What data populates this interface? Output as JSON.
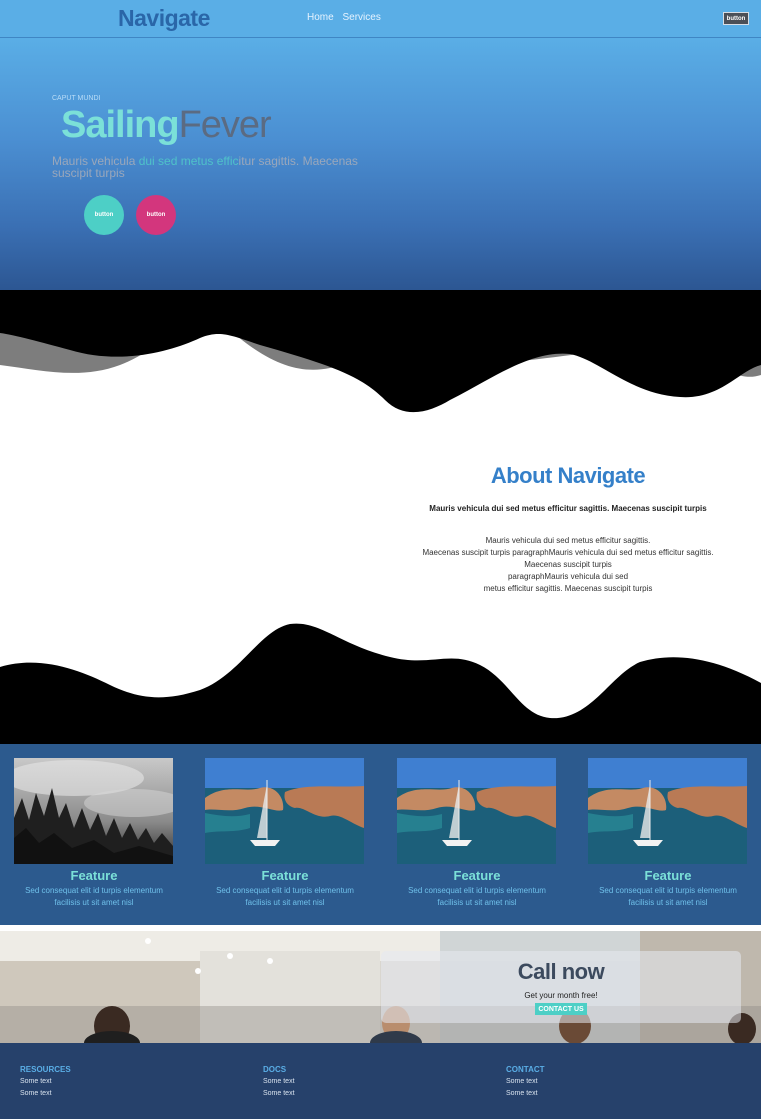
{
  "nav": {
    "brand": "Navigate",
    "links": [
      "Home",
      "Services"
    ],
    "button_label": "button"
  },
  "hero": {
    "kicker": "CAPUT MUNDI",
    "title_part1": "Sailing",
    "title_part2": "Fever",
    "subtitle_part1": "Mauris vehicula ",
    "subtitle_highlight": "dui sed metus effic",
    "subtitle_part2": "itur sagittis. Maecenas suscipit turpis",
    "button1_label": "button",
    "button2_label": "button"
  },
  "about": {
    "title": "About Navigate",
    "lead": "Mauris vehicula dui sed metus efficitur sagittis. Maecenas suscipit turpis",
    "body_lines": [
      "Mauris vehicula dui sed metus efficitur sagittis.",
      "Maecenas suscipit turpis paragraphMauris vehicula dui sed metus efficitur sagittis.",
      "Maecenas suscipit turpis",
      "paragraphMauris vehicula dui sed",
      "metus efficitur sagittis. Maecenas suscipit turpis"
    ]
  },
  "features": [
    {
      "title": "Feature",
      "desc": "Sed consequat elit id turpis elementum facilisis ut sit amet nisl",
      "image": "misty-forest"
    },
    {
      "title": "Feature",
      "desc": "Sed consequat elit id turpis elementum facilisis ut sit amet nisl",
      "image": "sailboat-cove"
    },
    {
      "title": "Feature",
      "desc": "Sed consequat elit id turpis elementum facilisis ut sit amet nisl",
      "image": "sailboat-cove"
    },
    {
      "title": "Feature",
      "desc": "Sed consequat elit id turpis elementum facilisis ut sit amet nisl",
      "image": "sailboat-cove"
    }
  ],
  "call": {
    "title": "Call now",
    "subtitle": "Get your month free!",
    "button_label": "CONTACT US"
  },
  "footer": {
    "columns": [
      {
        "heading": "RESOURCES",
        "links": [
          "Some text",
          "Some text"
        ]
      },
      {
        "heading": "DOCS",
        "links": [
          "Some text",
          "Some text"
        ]
      },
      {
        "heading": "CONTACT",
        "links": [
          "Some text",
          "Some text"
        ]
      }
    ]
  },
  "colors": {
    "nav_bg": "#5aaee6",
    "accent_teal": "#4dcfc6",
    "accent_pink": "#d3367d",
    "brand_blue": "#3580c9",
    "features_bg": "#2c5a8e",
    "footer_bg": "#26416b"
  }
}
